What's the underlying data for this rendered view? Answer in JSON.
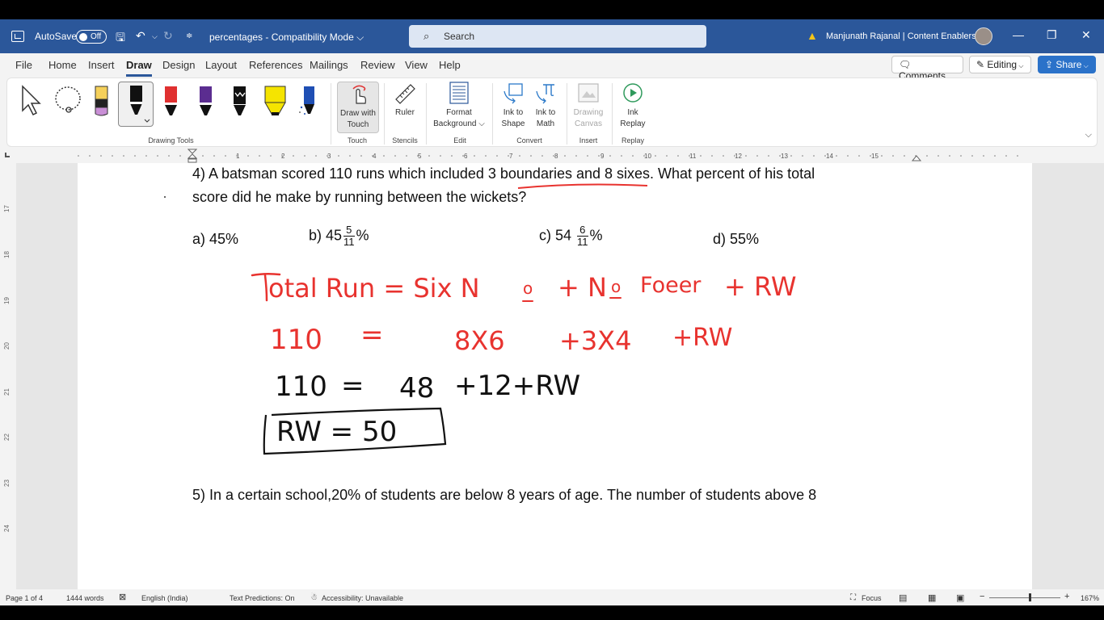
{
  "titlebar": {
    "autosave_label": "AutoSave",
    "autosave_state": "Off",
    "doc_title": "percentages  -  Compatibility Mode  ⌵",
    "search_placeholder": "Search",
    "user_name": "Manjunath Rajanal | Content Enablers"
  },
  "menu": {
    "tabs": [
      "File",
      "Home",
      "Insert",
      "Draw",
      "Design",
      "Layout",
      "References",
      "Mailings",
      "Review",
      "View",
      "Help"
    ],
    "active_tab": "Draw",
    "comments_label": "Comments",
    "editing_label": "Editing",
    "share_label": "Share"
  },
  "ribbon": {
    "groups": {
      "drawing_tools": "Drawing Tools",
      "touch": "Touch",
      "stencils": "Stencils",
      "edit": "Edit",
      "convert": "Convert",
      "insert": "Insert",
      "replay": "Replay"
    },
    "draw_with_touch": [
      "Draw with",
      "Touch"
    ],
    "ruler": "Ruler",
    "format_background": [
      "Format",
      "Background ⌵"
    ],
    "ink_to_shape": [
      "Ink to",
      "Shape"
    ],
    "ink_to_math": [
      "Ink to",
      "Math"
    ],
    "drawing_canvas": [
      "Drawing",
      "Canvas"
    ],
    "ink_replay": [
      "Ink",
      "Replay"
    ],
    "pen_colors": [
      "#000000",
      "#e03030",
      "#5b2d90",
      "#000000",
      "#f5e400",
      "#1f4fb4"
    ]
  },
  "ruler": {
    "ticks": [
      "1",
      "2",
      "3",
      "4",
      "5",
      "6",
      "7",
      "8",
      "9",
      "10",
      "11",
      "12",
      "13",
      "14",
      "15"
    ],
    "vertical_ticks": [
      "17",
      "18",
      "19",
      "20",
      "21",
      "22",
      "23",
      "24"
    ]
  },
  "document": {
    "q4_line1": "4) A batsman scored 110 runs which included 3 boundaries and 8 sixes. What percent of his total",
    "q4_line2": "score did he make by running between the wickets?",
    "opt_a": "a) 45%",
    "opt_b_prefix": "b) 45",
    "opt_b_num": "5",
    "opt_b_den": "11",
    "opt_b_suffix": "%",
    "opt_c_prefix": "c) 54 ",
    "opt_c_num": "6",
    "opt_c_den": "11",
    "opt_c_suffix": "%",
    "opt_d": "d) 55%",
    "q5_line1": "5) In a certain school,20% of students are below 8 years of age. The number of students above 8"
  },
  "handwriting": {
    "line1": "Total Run = Six No + No Foeer + RW",
    "line2": "110 = 8X6 + 3X4 + RW",
    "line3": "110 = 48 +12+RW",
    "line4": "RW = 50",
    "ink_red": "#e8332f",
    "ink_black": "#111111"
  },
  "status": {
    "page": "Page 1 of 4",
    "words": "1444 words",
    "language": "English (India)",
    "text_predictions": "Text Predictions: On",
    "accessibility": "Accessibility: Unavailable",
    "focus": "Focus",
    "zoom": "167%"
  }
}
